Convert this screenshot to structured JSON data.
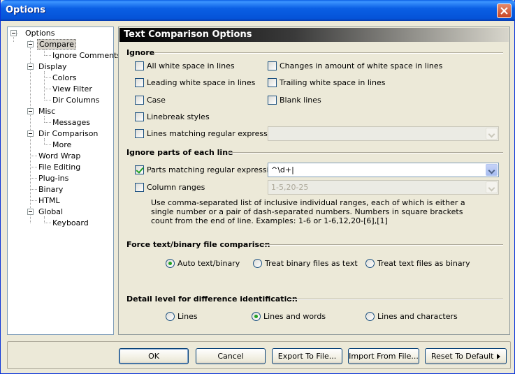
{
  "window": {
    "title": "Options"
  },
  "tree": {
    "root": "Options",
    "items": [
      "Compare",
      "Ignore Comments",
      "Display",
      "Colors",
      "View Filter",
      "Dir Columns",
      "Misc",
      "Messages",
      "Dir Comparison",
      "More",
      "Word Wrap",
      "File Editing",
      "Plug-ins",
      "Binary",
      "HTML",
      "Global",
      "Keyboard"
    ],
    "selected": "Compare"
  },
  "panel": {
    "header": "Text Comparison Options"
  },
  "ignore": {
    "title": "Ignore",
    "all_whitespace": "All white space in lines",
    "changes_whitespace": "Changes in amount of white space in lines",
    "leading_whitespace": "Leading white space in lines",
    "trailing_whitespace": "Trailing white space in lines",
    "case": "Case",
    "blank_lines": "Blank lines",
    "linebreak": "Linebreak styles",
    "lines_regex": "Lines matching regular expression",
    "lines_regex_value": ""
  },
  "ignore_parts": {
    "title": "Ignore parts of each line",
    "parts_regex": "Parts matching regular expression",
    "parts_regex_value": "^\\d+|",
    "column_ranges": "Column ranges",
    "column_ranges_value": "1-5,20-25",
    "description": "Use comma-separated list of inclusive individual ranges, each of which is either a single number or a pair of dash-separated numbers. Numbers in square brackets count from the end of line. Examples: 1-6 or 1-6,12,20-[6],[1]"
  },
  "force": {
    "title": "Force text/binary file comparison",
    "auto": "Auto text/binary",
    "treat_binary_as_text": "Treat binary files as text",
    "treat_text_as_binary": "Treat text files as binary"
  },
  "detail": {
    "title": "Detail level for difference identification",
    "lines": "Lines",
    "lines_words": "Lines and words",
    "lines_chars": "Lines and characters"
  },
  "buttons": {
    "ok": "OK",
    "cancel": "Cancel",
    "export": "Export To File...",
    "import": "Import From File...",
    "reset": "Reset To Default"
  }
}
